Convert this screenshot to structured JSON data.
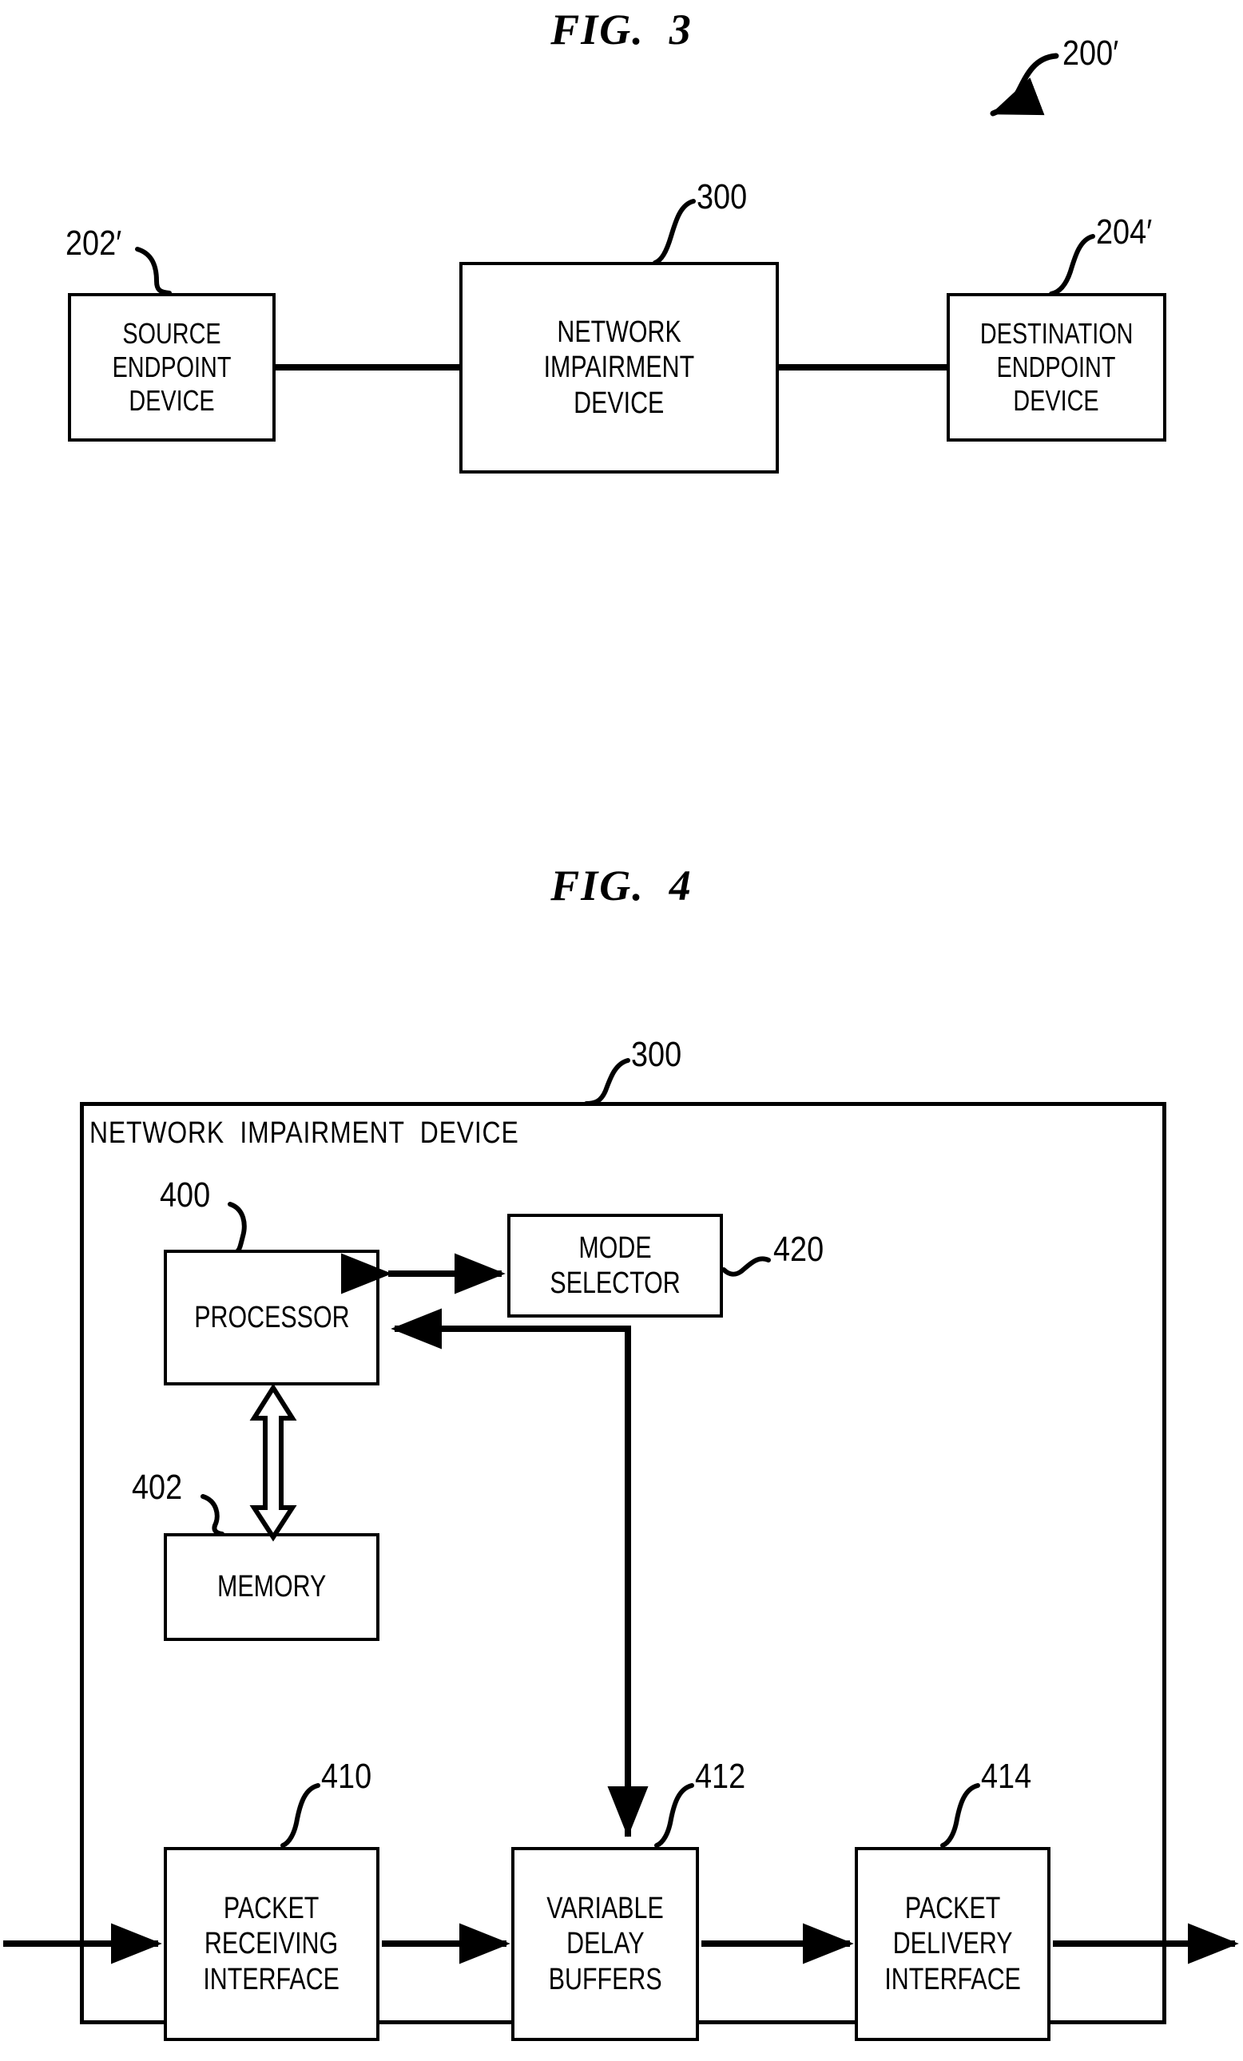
{
  "figures": [
    {
      "title": "FIG.  3",
      "reference": "200′",
      "blocks": [
        {
          "ref": "202′",
          "lines": [
            "SOURCE",
            "ENDPOINT",
            "DEVICE"
          ]
        },
        {
          "ref": "300",
          "lines": [
            "NETWORK",
            "IMPAIRMENT",
            "DEVICE"
          ]
        },
        {
          "ref": "204′",
          "lines": [
            "DESTINATION",
            "ENDPOINT",
            "DEVICE"
          ]
        }
      ]
    },
    {
      "title": "FIG.  4",
      "reference": "300",
      "outer_label": "NETWORK  IMPAIRMENT  DEVICE",
      "blocks": [
        {
          "ref": "400",
          "lines": [
            "PROCESSOR"
          ]
        },
        {
          "ref": "420",
          "lines": [
            "MODE",
            "SELECTOR"
          ]
        },
        {
          "ref": "402",
          "lines": [
            "MEMORY"
          ]
        },
        {
          "ref": "410",
          "lines": [
            "PACKET",
            "RECEIVING",
            "INTERFACE"
          ]
        },
        {
          "ref": "412",
          "lines": [
            "VARIABLE",
            "DELAY",
            "BUFFERS"
          ]
        },
        {
          "ref": "414",
          "lines": [
            "PACKET",
            "DELIVERY",
            "INTERFACE"
          ]
        }
      ]
    }
  ],
  "fig3": {
    "title": "FIG.  3",
    "ref_system": "200′",
    "source": {
      "ref": "202′",
      "l1": "SOURCE",
      "l2": "ENDPOINT",
      "l3": "DEVICE"
    },
    "impairment": {
      "ref": "300",
      "l1": "NETWORK",
      "l2": "IMPAIRMENT",
      "l3": "DEVICE"
    },
    "destination": {
      "ref": "204′",
      "l1": "DESTINATION",
      "l2": "ENDPOINT",
      "l3": "DEVICE"
    }
  },
  "fig4": {
    "title": "FIG.  4",
    "ref_device": "300",
    "device_label": "NETWORK  IMPAIRMENT  DEVICE",
    "processor": {
      "ref": "400",
      "l1": "PROCESSOR"
    },
    "mode_selector": {
      "ref": "420",
      "l1": "MODE",
      "l2": "SELECTOR"
    },
    "memory": {
      "ref": "402",
      "l1": "MEMORY"
    },
    "packet_receiving": {
      "ref": "410",
      "l1": "PACKET",
      "l2": "RECEIVING",
      "l3": "INTERFACE"
    },
    "variable_delay": {
      "ref": "412",
      "l1": "VARIABLE",
      "l2": "DELAY",
      "l3": "BUFFERS"
    },
    "packet_delivery": {
      "ref": "414",
      "l1": "PACKET",
      "l2": "DELIVERY",
      "l3": "INTERFACE"
    }
  },
  "colors": {
    "ink": "#000000",
    "paper": "#ffffff"
  }
}
